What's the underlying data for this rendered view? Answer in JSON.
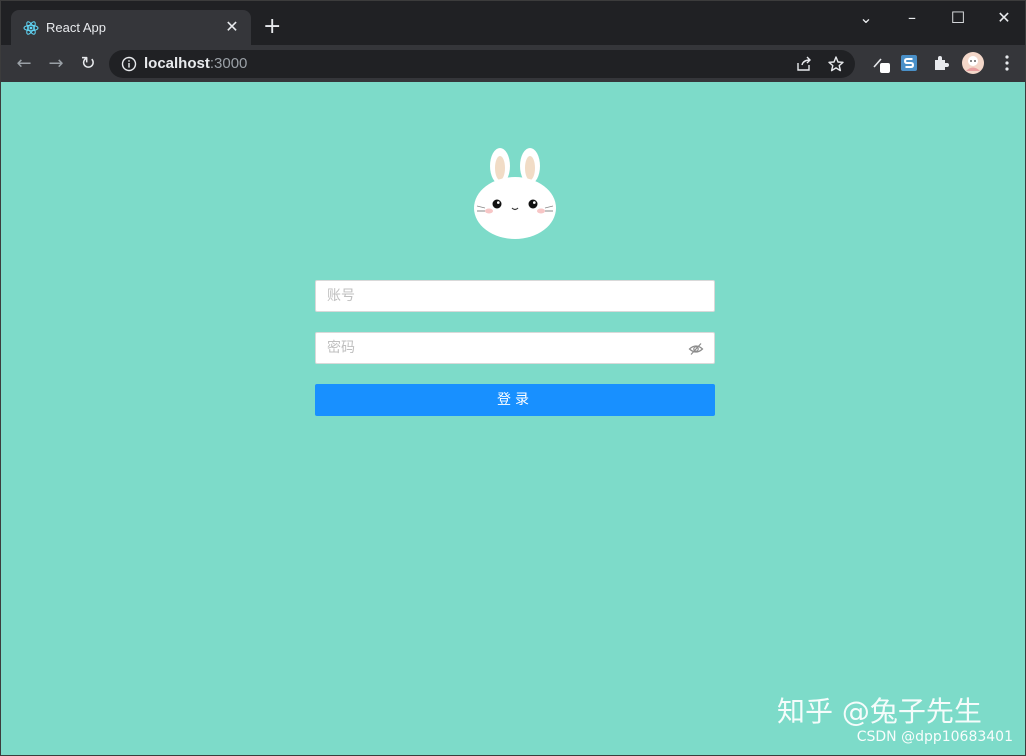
{
  "browser": {
    "tab": {
      "title": "React App",
      "favicon": "react-icon",
      "close_glyph": "✕"
    },
    "new_tab_glyph": "+",
    "window_controls": {
      "tab_search_glyph": "⌄",
      "minimize_glyph": "–",
      "maximize_glyph": "☐",
      "close_glyph": "✕"
    },
    "nav": {
      "back_glyph": "←",
      "forward_glyph": "→",
      "reload_glyph": "↻"
    },
    "address": {
      "host": "localhost",
      "port": ":3000"
    },
    "accent": "#35363a"
  },
  "page": {
    "background": "#7ddbc9",
    "logo": "bunny-icon",
    "form": {
      "account_placeholder": "账号",
      "password_placeholder": "密码",
      "submit_label": "登录",
      "button_color": "#1890ff"
    },
    "watermark": "知乎 @兔子先生",
    "credit": "CSDN @dpp10683401"
  }
}
